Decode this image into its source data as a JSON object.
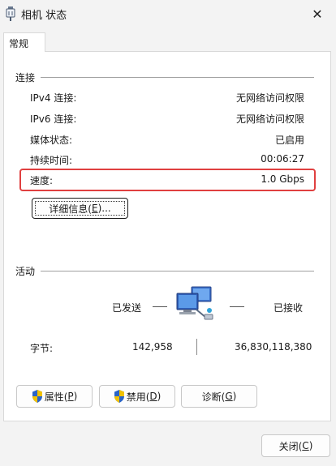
{
  "window": {
    "title": "相机 状态",
    "close_glyph": "✕"
  },
  "tab": {
    "label": "常规"
  },
  "connection": {
    "group_label": "连接",
    "rows": [
      {
        "label": "IPv4 连接:",
        "value": "无网络访问权限"
      },
      {
        "label": "IPv6 连接:",
        "value": "无网络访问权限"
      },
      {
        "label": "媒体状态:",
        "value": "已启用"
      },
      {
        "label": "持续时间:",
        "value": "00:06:27"
      },
      {
        "label": "速度:",
        "value": "1.0 Gbps"
      }
    ],
    "details_button": {
      "text": "详细信息(",
      "key": "E",
      "suffix": ")..."
    }
  },
  "activity": {
    "group_label": "活动",
    "sent_label": "已发送",
    "received_label": "已接收",
    "bytes_label": "字节:",
    "bytes_sent": "142,958",
    "bytes_received": "36,830,118,380"
  },
  "buttons": {
    "properties": {
      "text": "属性(",
      "key": "P",
      "suffix": ")"
    },
    "disable": {
      "text": "禁用(",
      "key": "D",
      "suffix": ")"
    },
    "diagnose": {
      "text": "诊断(",
      "key": "G",
      "suffix": ")"
    },
    "close": {
      "text": "关闭(",
      "key": "C",
      "suffix": ")"
    }
  },
  "colors": {
    "highlight": "#e04040",
    "shield_blue": "#2a64c8",
    "shield_yellow": "#f2c200"
  }
}
